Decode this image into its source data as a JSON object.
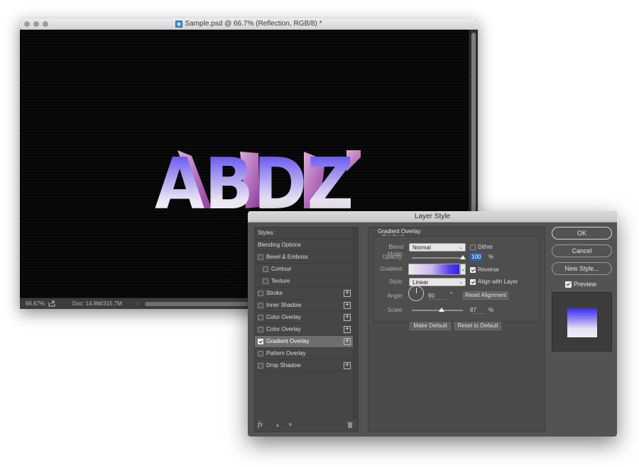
{
  "document_window": {
    "title": "Sample.psd @ 66.7% (Reflection, RGB/8) *",
    "canvas_text": "ABDZ",
    "status": {
      "zoom": "66.67%",
      "doc_info": "Doc: 14.8M/315.7M",
      "arrow": "›"
    }
  },
  "dialog": {
    "title": "Layer Style",
    "styles_header": "Styles",
    "blending_options": "Blending Options",
    "items": [
      {
        "label": "Bevel & Emboss",
        "checked": false,
        "plus": false,
        "indent": false
      },
      {
        "label": "Contour",
        "checked": false,
        "plus": false,
        "indent": true
      },
      {
        "label": "Texture",
        "checked": false,
        "plus": false,
        "indent": true
      },
      {
        "label": "Stroke",
        "checked": false,
        "plus": true,
        "indent": false
      },
      {
        "label": "Inner Shadow",
        "checked": false,
        "plus": true,
        "indent": false
      },
      {
        "label": "Color Overlay",
        "checked": false,
        "plus": true,
        "indent": false
      },
      {
        "label": "Color Overlay",
        "checked": false,
        "plus": true,
        "indent": false
      },
      {
        "label": "Gradient Overlay",
        "checked": true,
        "plus": true,
        "indent": false,
        "selected": true
      },
      {
        "label": "Pattern Overlay",
        "checked": false,
        "plus": false,
        "indent": false
      },
      {
        "label": "Drop Shadow",
        "checked": false,
        "plus": true,
        "indent": false
      }
    ],
    "panel": {
      "section_title": "Gradient Overlay",
      "group_title": "Gradient",
      "blend_mode_label": "Blend Mode:",
      "blend_mode_value": "Normal",
      "dither_label": "Dither",
      "opacity_label": "Opacity:",
      "opacity_value": "100",
      "opacity_fraction": 1.0,
      "percent": "%",
      "gradient_label": "Gradient:",
      "reverse_label": "Reverse",
      "style_label": "Style:",
      "style_value": "Linear",
      "align_label": "Align with Layer",
      "angle_label": "Angle:",
      "angle_value": "90",
      "degree": "°",
      "reset_alignment": "Reset Alignment",
      "scale_label": "Scale:",
      "scale_value": "87",
      "scale_fraction": 0.58,
      "make_default": "Make Default",
      "reset_default": "Reset to Default"
    },
    "buttons": {
      "ok": "OK",
      "cancel": "Cancel",
      "new_style": "New Style...",
      "preview": "Preview"
    },
    "footer": {
      "fx": "fx"
    }
  },
  "colors": {
    "gradient_top": "#3a2cf0",
    "gradient_bottom": "#f2eef4",
    "selection": "#2f5fb5"
  }
}
